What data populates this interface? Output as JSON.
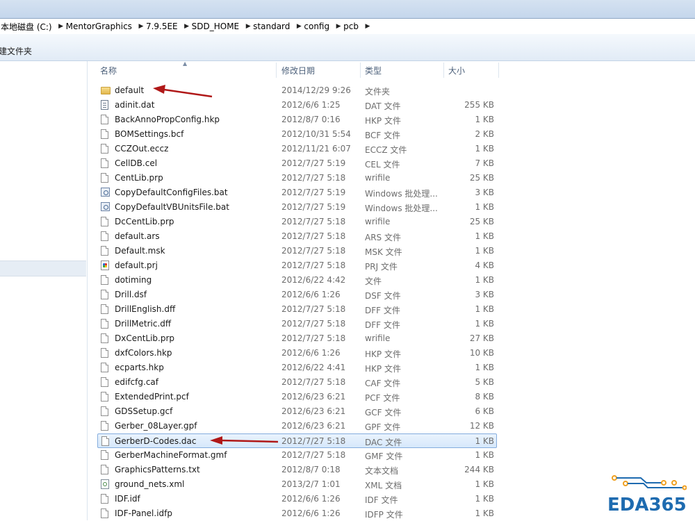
{
  "breadcrumbs": [
    {
      "label": "本地磁盘 (C:)"
    },
    {
      "label": "MentorGraphics"
    },
    {
      "label": "7.9.5EE"
    },
    {
      "label": "SDD_HOME"
    },
    {
      "label": "standard"
    },
    {
      "label": "config"
    },
    {
      "label": "pcb"
    }
  ],
  "toolbar": {
    "new_folder_label": "建文件夹"
  },
  "columns": {
    "name": "名称",
    "date": "修改日期",
    "type": "类型",
    "size": "大小"
  },
  "files": [
    {
      "name": "default",
      "date": "2014/12/29 9:26",
      "type": "文件夹",
      "size": "",
      "icon": "folder-icon"
    },
    {
      "name": "adinit.dat",
      "date": "2012/6/6 1:25",
      "type": "DAT 文件",
      "size": "255 KB",
      "icon": "data-file-icon"
    },
    {
      "name": "BackAnnoPropConfig.hkp",
      "date": "2012/8/7 0:16",
      "type": "HKP 文件",
      "size": "1 KB",
      "icon": "file-icon"
    },
    {
      "name": "BOMSettings.bcf",
      "date": "2012/10/31 5:54",
      "type": "BCF 文件",
      "size": "2 KB",
      "icon": "file-icon"
    },
    {
      "name": "CCZOut.eccz",
      "date": "2012/11/21 6:07",
      "type": "ECCZ 文件",
      "size": "1 KB",
      "icon": "file-icon"
    },
    {
      "name": "CellDB.cel",
      "date": "2012/7/27 5:19",
      "type": "CEL 文件",
      "size": "7 KB",
      "icon": "file-icon"
    },
    {
      "name": "CentLib.prp",
      "date": "2012/7/27 5:18",
      "type": "wrifile",
      "size": "25 KB",
      "icon": "file-icon"
    },
    {
      "name": "CopyDefaultConfigFiles.bat",
      "date": "2012/7/27 5:19",
      "type": "Windows 批处理...",
      "size": "3 KB",
      "icon": "batch-file-icon"
    },
    {
      "name": "CopyDefaultVBUnitsFile.bat",
      "date": "2012/7/27 5:19",
      "type": "Windows 批处理...",
      "size": "1 KB",
      "icon": "batch-file-icon"
    },
    {
      "name": "DcCentLib.prp",
      "date": "2012/7/27 5:18",
      "type": "wrifile",
      "size": "25 KB",
      "icon": "file-icon"
    },
    {
      "name": "default.ars",
      "date": "2012/7/27 5:18",
      "type": "ARS 文件",
      "size": "1 KB",
      "icon": "file-icon"
    },
    {
      "name": "Default.msk",
      "date": "2012/7/27 5:18",
      "type": "MSK 文件",
      "size": "1 KB",
      "icon": "file-icon"
    },
    {
      "name": "default.prj",
      "date": "2012/7/27 5:18",
      "type": "PRJ 文件",
      "size": "4 KB",
      "icon": "project-file-icon"
    },
    {
      "name": "dotiming",
      "date": "2012/6/22 4:42",
      "type": "文件",
      "size": "1 KB",
      "icon": "file-icon"
    },
    {
      "name": "Drill.dsf",
      "date": "2012/6/6 1:26",
      "type": "DSF 文件",
      "size": "3 KB",
      "icon": "file-icon"
    },
    {
      "name": "DrillEnglish.dff",
      "date": "2012/7/27 5:18",
      "type": "DFF 文件",
      "size": "1 KB",
      "icon": "file-icon"
    },
    {
      "name": "DrillMetric.dff",
      "date": "2012/7/27 5:18",
      "type": "DFF 文件",
      "size": "1 KB",
      "icon": "file-icon"
    },
    {
      "name": "DxCentLib.prp",
      "date": "2012/7/27 5:18",
      "type": "wrifile",
      "size": "27 KB",
      "icon": "file-icon"
    },
    {
      "name": "dxfColors.hkp",
      "date": "2012/6/6 1:26",
      "type": "HKP 文件",
      "size": "10 KB",
      "icon": "file-icon"
    },
    {
      "name": "ecparts.hkp",
      "date": "2012/6/22 4:41",
      "type": "HKP 文件",
      "size": "1 KB",
      "icon": "file-icon"
    },
    {
      "name": "edifcfg.caf",
      "date": "2012/7/27 5:18",
      "type": "CAF 文件",
      "size": "5 KB",
      "icon": "file-icon"
    },
    {
      "name": "ExtendedPrint.pcf",
      "date": "2012/6/23 6:21",
      "type": "PCF 文件",
      "size": "8 KB",
      "icon": "file-icon"
    },
    {
      "name": "GDSSetup.gcf",
      "date": "2012/6/23 6:21",
      "type": "GCF 文件",
      "size": "6 KB",
      "icon": "file-icon"
    },
    {
      "name": "Gerber_08Layer.gpf",
      "date": "2012/6/23 6:21",
      "type": "GPF 文件",
      "size": "12 KB",
      "icon": "file-icon"
    },
    {
      "name": "GerberD-Codes.dac",
      "date": "2012/7/27 5:18",
      "type": "DAC 文件",
      "size": "1 KB",
      "icon": "file-icon",
      "selected": true
    },
    {
      "name": "GerberMachineFormat.gmf",
      "date": "2012/7/27 5:18",
      "type": "GMF 文件",
      "size": "1 KB",
      "icon": "file-icon"
    },
    {
      "name": "GraphicsPatterns.txt",
      "date": "2012/8/7 0:18",
      "type": "文本文档",
      "size": "244 KB",
      "icon": "file-icon"
    },
    {
      "name": "ground_nets.xml",
      "date": "2013/2/7 1:01",
      "type": "XML 文档",
      "size": "1 KB",
      "icon": "xml-file-icon"
    },
    {
      "name": "IDF.idf",
      "date": "2012/6/6 1:26",
      "type": "IDF 文件",
      "size": "1 KB",
      "icon": "file-icon"
    },
    {
      "name": "IDF-Panel.idfp",
      "date": "2012/6/6 1:26",
      "type": "IDFP 文件",
      "size": "1 KB",
      "icon": "file-icon"
    }
  ],
  "logo": {
    "text": "EDA365"
  },
  "colors": {
    "arrow": "#b01818",
    "logo_blue": "#1e6bb0",
    "logo_orange": "#f0a020",
    "selection_border": "#84acdd"
  }
}
